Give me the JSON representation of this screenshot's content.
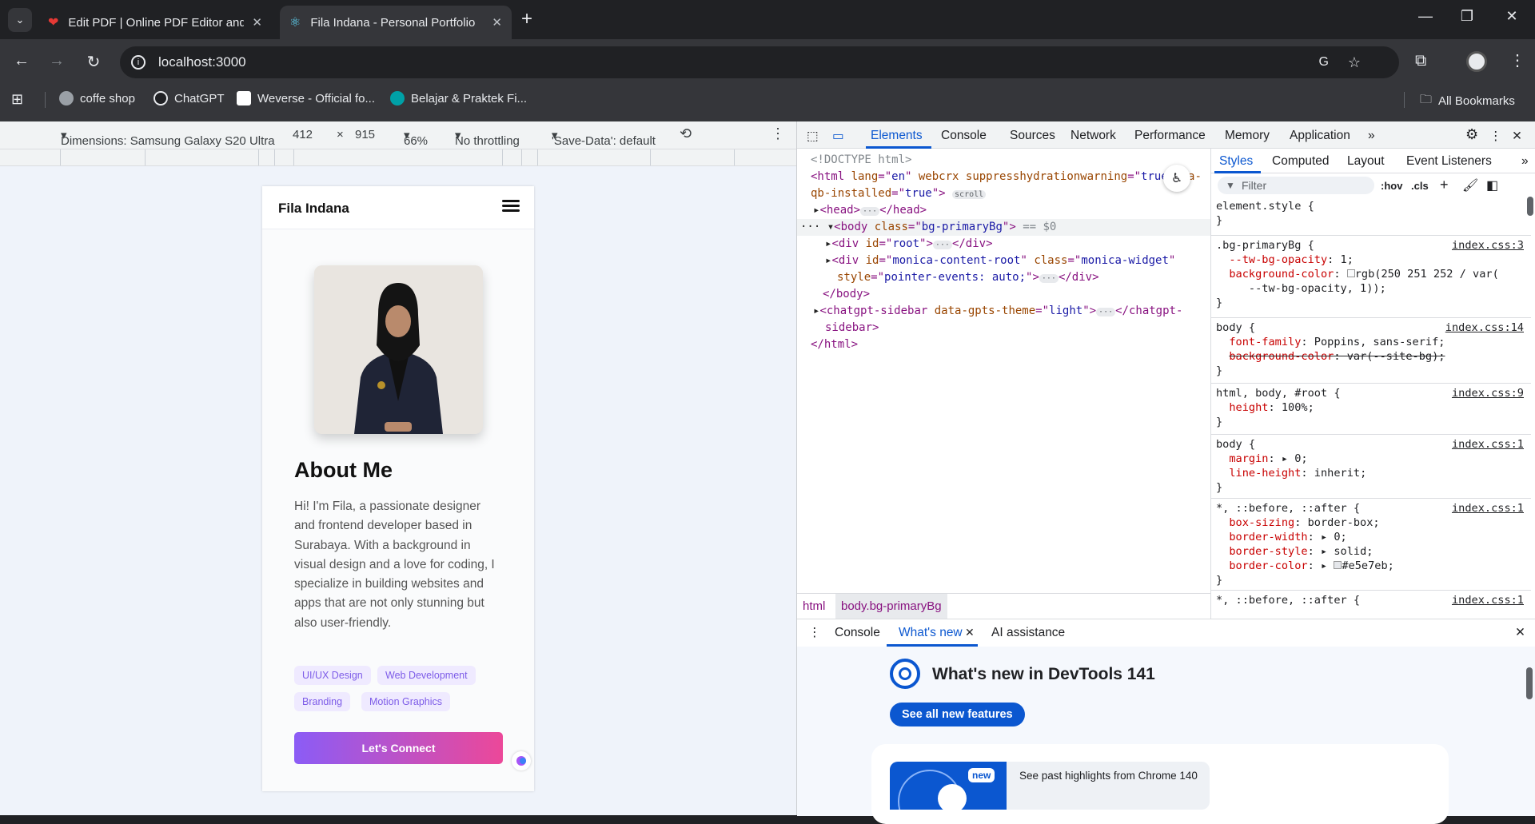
{
  "browser": {
    "tabs": [
      {
        "title": "Edit PDF | Online PDF Editor and",
        "active": false
      },
      {
        "title": "Fila Indana - Personal Portfolio",
        "active": true
      }
    ],
    "url": "localhost:3000",
    "bookmarks": [
      "coffe shop",
      "ChatGPT",
      "Weverse - Official fo...",
      "Belajar & Praktek Fi..."
    ],
    "all_bookmarks": "All Bookmarks"
  },
  "device_toolbar": {
    "dimensions": "Dimensions: Samsung Galaxy S20 Ultra",
    "width": "412",
    "times": "×",
    "height": "915",
    "zoom": "66%",
    "throttling": "No throttling",
    "save_data": "'Save-Data': default"
  },
  "page": {
    "brand": "Fila Indana",
    "about_title": "About Me",
    "about_text": "Hi! I'm Fila, a passionate designer and frontend developer based in Surabaya. With a background in visual design and a love for coding, I specialize in building websites and apps that are not only stunning but also user-friendly.",
    "tags": [
      "UI/UX Design",
      "Web Development",
      "Branding",
      "Motion Graphics"
    ],
    "cta": "Let's Connect"
  },
  "devtools": {
    "tabs": [
      "Elements",
      "Console",
      "Sources",
      "Network",
      "Performance",
      "Memory",
      "Application"
    ],
    "styles_tabs": [
      "Styles",
      "Computed",
      "Layout",
      "Event Listeners"
    ],
    "filter_placeholder": "Filter",
    "hov": ":hov",
    "cls": ".cls",
    "breadcrumb": [
      "html",
      "body.bg-primaryBg"
    ],
    "drawer_tabs": [
      "Console",
      "What's new",
      "AI assistance"
    ],
    "whats_new_title": "What's new in DevTools 141",
    "see_all": "See all new features",
    "highlight": "See past highlights from Chrome 140",
    "new_badge": "new"
  },
  "colors": {
    "accent": "#0b57d0",
    "cta_start": "#8b5cf6",
    "cta_end": "#ec4899",
    "chip_bg": "#efeaff",
    "chip_text": "#7d5ce8"
  }
}
